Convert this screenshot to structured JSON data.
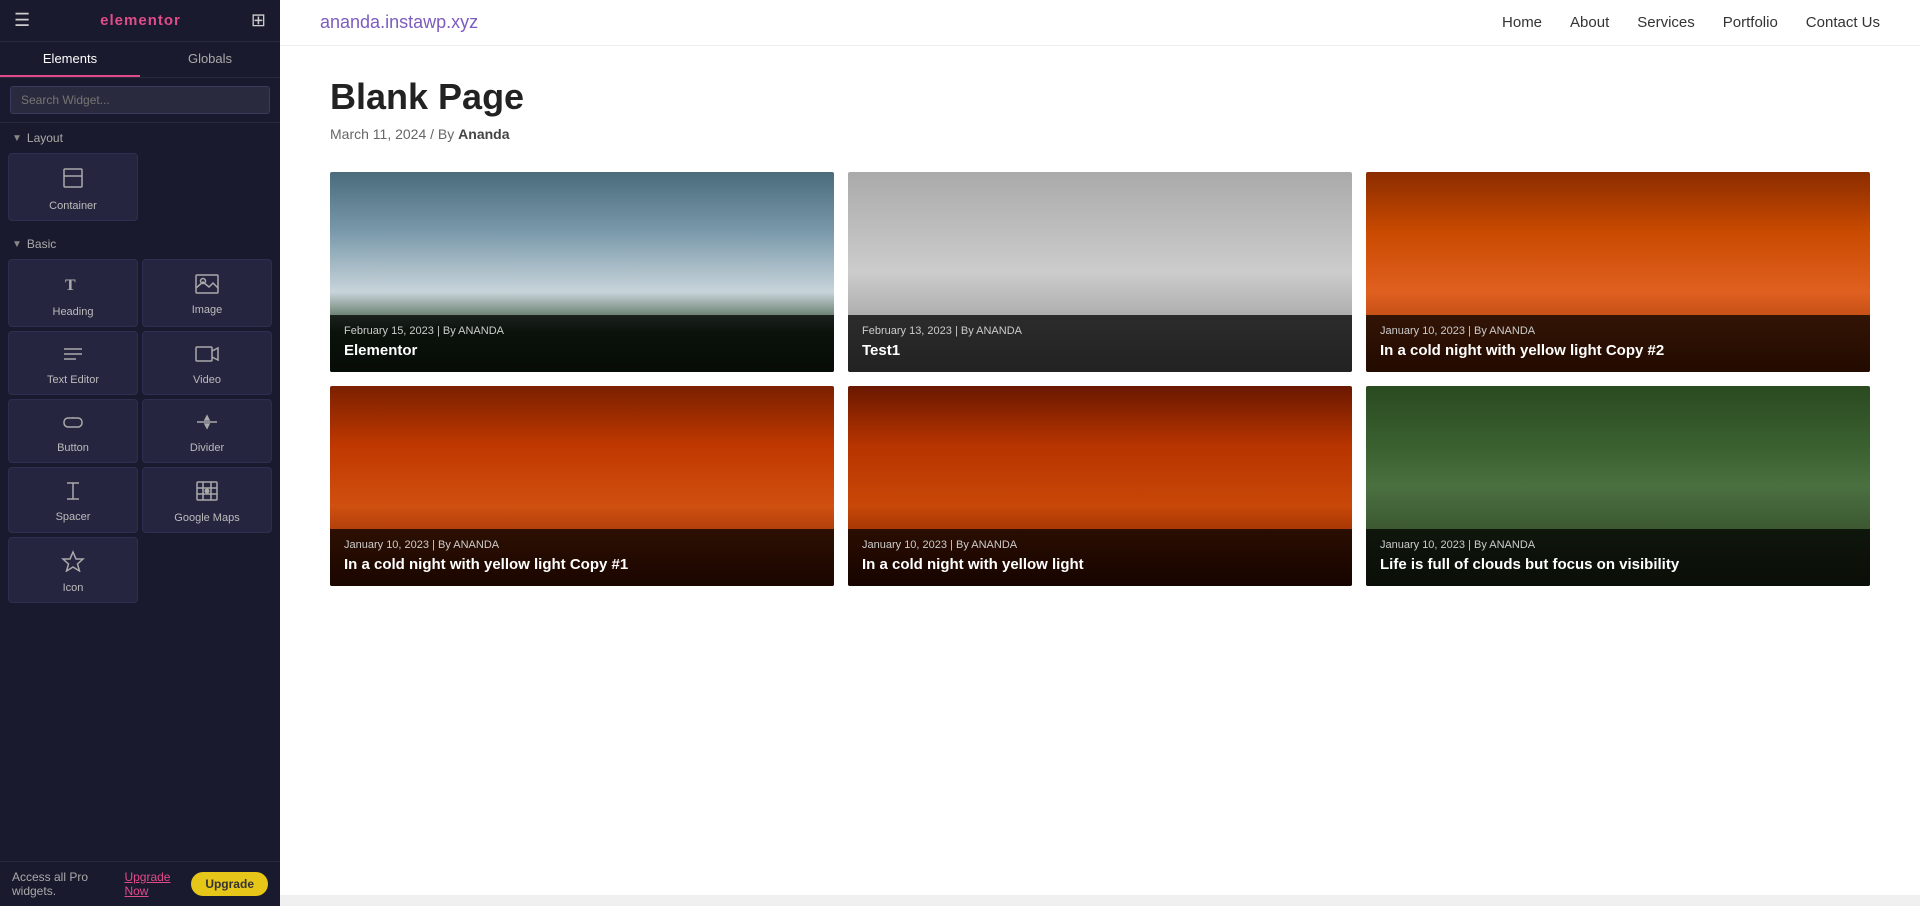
{
  "sidebar": {
    "logo": "elementor",
    "hamburger": "☰",
    "grid": "⊞",
    "tabs": [
      {
        "label": "Elements",
        "active": true
      },
      {
        "label": "Globals",
        "active": false
      }
    ],
    "search_placeholder": "Search Widget...",
    "sections": [
      {
        "label": "Layout",
        "widgets": [
          {
            "icon": "▣",
            "label": "Container"
          }
        ]
      },
      {
        "label": "Basic",
        "widgets": [
          {
            "icon": "T",
            "label": "Heading"
          },
          {
            "icon": "🖼",
            "label": "Image"
          },
          {
            "icon": "≡",
            "label": "Text Editor"
          },
          {
            "icon": "▶",
            "label": "Video"
          },
          {
            "icon": "⊕",
            "label": "Button"
          },
          {
            "icon": "—",
            "label": "Divider"
          },
          {
            "icon": "⊠",
            "label": "Spacer"
          },
          {
            "icon": "📍",
            "label": "Google Maps"
          },
          {
            "icon": "★",
            "label": "Icon"
          }
        ]
      }
    ],
    "bottom": {
      "access_text": "Access all Pro widgets.",
      "upgrade_link_text": "Upgrade Now",
      "upgrade_btn_text": "Upgrade"
    }
  },
  "nav": {
    "domain": "ananda.instawp.xyz",
    "links": [
      {
        "label": "Home"
      },
      {
        "label": "About"
      },
      {
        "label": "Services"
      },
      {
        "label": "Portfolio"
      },
      {
        "label": "Contact Us"
      }
    ]
  },
  "page": {
    "title": "Blank Page",
    "meta_date": "March 11, 2024",
    "meta_by": "By",
    "meta_author": "Ananda",
    "posts": [
      {
        "date": "February 15, 2023 | By ANANDA",
        "title": "Elementor",
        "img_class": "img-stormy"
      },
      {
        "date": "February 13, 2023 | By ANANDA",
        "title": "Test1",
        "img_class": "img-gray"
      },
      {
        "date": "January 10, 2023 | By ANANDA",
        "title": "In a cold night with yellow light Copy #2",
        "img_class": "img-autumn1"
      },
      {
        "date": "January 10, 2023 | By ANANDA",
        "title": "In a cold night with yellow light Copy #1",
        "img_class": "img-autumn2"
      },
      {
        "date": "January 10, 2023 | By ANANDA",
        "title": "In a cold night with yellow light",
        "img_class": "img-autumn3"
      },
      {
        "date": "January 10, 2023 | By ANANDA",
        "title": "Life is full of clouds but focus on visibility",
        "img_class": "img-forest"
      }
    ]
  }
}
